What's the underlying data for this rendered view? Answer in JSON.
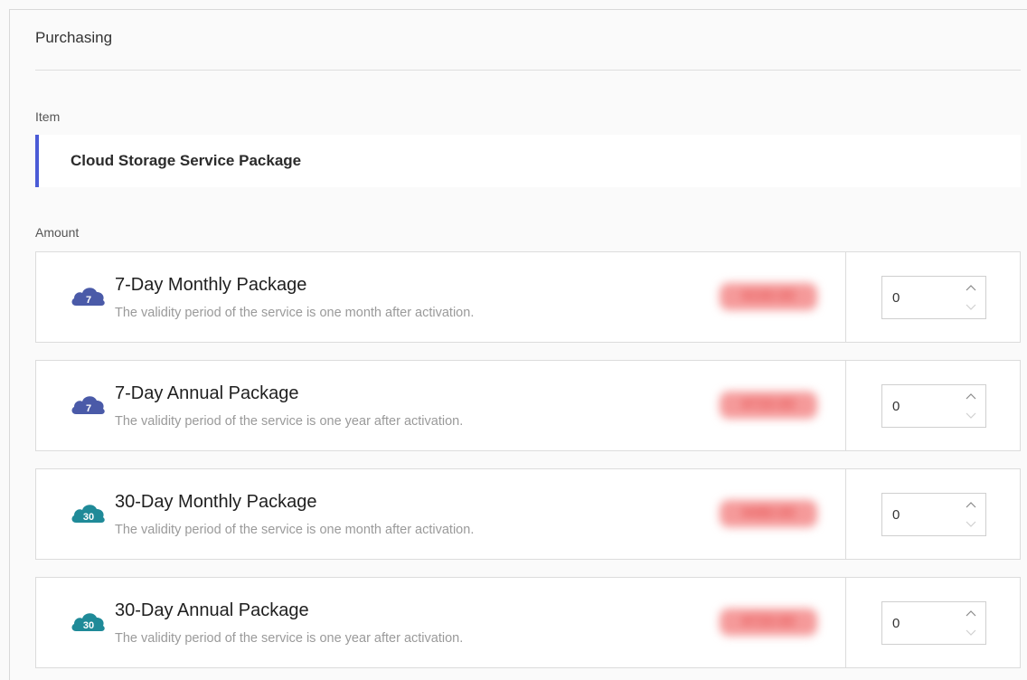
{
  "page": {
    "title": "Purchasing"
  },
  "item": {
    "label": "Item",
    "name": "Cloud Storage Service Package"
  },
  "amount": {
    "label": "Amount"
  },
  "accent_color": "#4a5bd6",
  "packages": [
    {
      "name": "7-Day Monthly Package",
      "description": "The validity period of the service is one month after activation.",
      "icon": "cloud-7-icon",
      "icon_label": "7",
      "icon_color": "#4a5aa8",
      "price": "¥100.00",
      "quantity": "0"
    },
    {
      "name": "7-Day Annual Package",
      "description": "The validity period of the service is one year after activation.",
      "icon": "cloud-7-icon",
      "icon_label": "7",
      "icon_color": "#4a5aa8",
      "price": "¥720.00",
      "quantity": "0"
    },
    {
      "name": "30-Day Monthly Package",
      "description": "The validity period of the service is one month after activation.",
      "icon": "cloud-30-icon",
      "icon_label": "30",
      "icon_color": "#1f8a98",
      "price": "¥480.00",
      "quantity": "0"
    },
    {
      "name": "30-Day Annual Package",
      "description": "The validity period of the service is one year after activation.",
      "icon": "cloud-30-icon",
      "icon_label": "30",
      "icon_color": "#1f8a98",
      "price": "¥720.00",
      "quantity": "0"
    }
  ]
}
